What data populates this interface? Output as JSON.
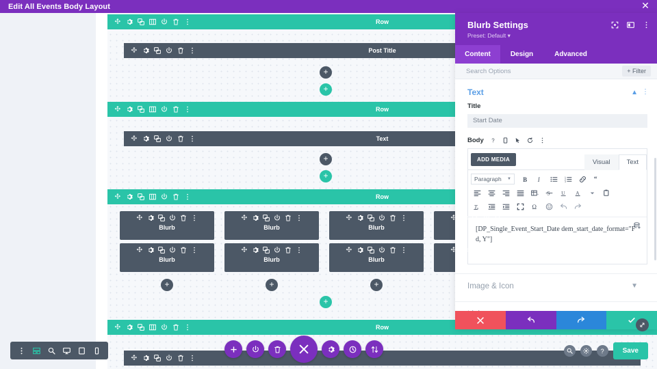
{
  "topbar": {
    "title": "Edit All Events Body Layout",
    "close_icon": "close-icon"
  },
  "canvas": {
    "row_label": "Row",
    "module_labels": {
      "post_title": "Post Title",
      "text": "Text",
      "blurb": "Blurb"
    },
    "bar_icons": [
      "move-icon",
      "gear-icon",
      "duplicate-icon",
      "columns-icon",
      "power-icon",
      "trash-icon",
      "more-icon"
    ],
    "module_icons": [
      "move-icon",
      "gear-icon",
      "duplicate-icon",
      "power-icon",
      "trash-icon",
      "more-icon"
    ],
    "add_label": "+",
    "rows": [
      {
        "label": "Row",
        "modules": [
          "Post Title"
        ]
      },
      {
        "label": "Row",
        "modules": [
          "Text"
        ]
      },
      {
        "label": "Row",
        "modules": [
          "Blurb",
          "Blurb",
          "Blurb",
          "Blurb",
          "Blurb",
          "Blurb",
          "Blurb",
          "Blurb"
        ]
      },
      {
        "label": "Row",
        "modules": []
      }
    ]
  },
  "view_toolbar": {
    "items": [
      "more-vertical-icon",
      "wireframe-icon",
      "zoom-icon",
      "desktop-icon",
      "tablet-icon",
      "phone-icon"
    ],
    "active": "wireframe-icon"
  },
  "fab_cluster": {
    "items": [
      "plus-icon",
      "power-icon",
      "trash-icon",
      "close-icon",
      "gear-icon",
      "history-icon",
      "sort-icon"
    ]
  },
  "bottom_right": {
    "icons": [
      "zoom-icon",
      "settings-icon",
      "help-icon"
    ],
    "save_label": "Save"
  },
  "panel": {
    "title": "Blurb Settings",
    "preset": "Preset: Default",
    "preset_caret": "▾",
    "header_icons": [
      "expand-icon",
      "layout-icon",
      "more-icon"
    ],
    "tabs": [
      {
        "label": "Content",
        "active": true
      },
      {
        "label": "Design",
        "active": false
      },
      {
        "label": "Advanced",
        "active": false
      }
    ],
    "search_placeholder": "Search Options",
    "filter_label": "+ Filter",
    "sections": [
      {
        "name": "Text",
        "expanded": true
      },
      {
        "name": "Image & Icon",
        "expanded": false
      },
      {
        "name": "Link",
        "expanded": false
      }
    ],
    "text_section": {
      "title_label": "Title",
      "title_value": "Start Date",
      "body_label": "Body",
      "body_icons": [
        "help-icon",
        "responsive-icon",
        "hover-icon",
        "reset-icon",
        "more-icon"
      ],
      "add_media_label": "ADD MEDIA",
      "editor_tabs": [
        {
          "label": "Visual",
          "active": true
        },
        {
          "label": "Text",
          "active": false
        }
      ],
      "format_select": "Paragraph",
      "toolbar_row1": [
        "bold-icon",
        "italic-icon",
        "bulleted-list-icon",
        "numbered-list-icon",
        "link-icon",
        "blockquote-icon"
      ],
      "toolbar_row2": [
        "align-left-icon",
        "align-center-icon",
        "align-right-icon",
        "align-justify-icon",
        "table-icon",
        "strikethrough-icon",
        "underline-icon",
        "text-color-icon",
        "paste-icon"
      ],
      "toolbar_row3": [
        "clear-formatting-icon",
        "outdent-icon",
        "indent-icon",
        "fullscreen-icon",
        "special-character-icon",
        "emoji-icon",
        "undo-icon",
        "redo-icon"
      ],
      "content": "[DP_Single_Event_Start_Date dem_start_date_format=\"F d, Y\"]",
      "dynamic_content_icon": "dynamic-content-icon"
    },
    "actions": [
      {
        "name": "cancel",
        "icon": "close-icon",
        "color": "#f0525c"
      },
      {
        "name": "undo",
        "icon": "undo-icon",
        "color": "#7b2fbe"
      },
      {
        "name": "redo",
        "icon": "redo-icon",
        "color": "#2b87da"
      },
      {
        "name": "save",
        "icon": "check-icon",
        "color": "#2ac4a8"
      }
    ],
    "resize_icon": "resize-icon"
  },
  "colors": {
    "purple": "#7b2fbe",
    "teal": "#2ac4a8",
    "dark": "#4c5866",
    "red": "#f0525c",
    "blue": "#2b87da",
    "canvas": "#eff2f7"
  }
}
